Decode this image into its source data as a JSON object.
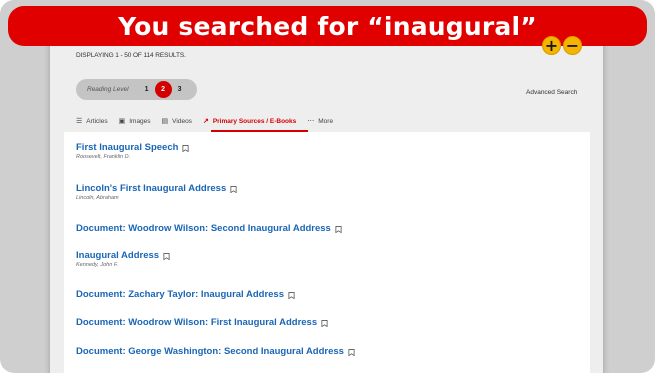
{
  "banner": {
    "title": "You searched for “inaugural”"
  },
  "zoom": {
    "in_label": "+",
    "out_label": "−"
  },
  "results_summary": "DISPLAYING 1 - 50 OF 114 RESULTS.",
  "reading_level": {
    "label": "Reading Level",
    "levels": [
      "1",
      "2",
      "3"
    ],
    "selected": "2"
  },
  "advanced_search_label": "Advanced Search",
  "tabs": [
    {
      "label": "Articles",
      "icon": "list-icon"
    },
    {
      "label": "Images",
      "icon": "image-icon"
    },
    {
      "label": "Videos",
      "icon": "film-icon"
    },
    {
      "label": "Primary Sources / E-Books",
      "icon": "external-link-icon",
      "active": true
    },
    {
      "label": "More",
      "icon": "ellipsis-icon"
    }
  ],
  "results": [
    {
      "title": "First Inaugural Speech",
      "author": "Roosevelt, Franklin D."
    },
    {
      "title": "Lincoln's First Inaugural Address",
      "author": "Lincoln, Abraham"
    },
    {
      "title": "Document: Woodrow Wilson: Second Inaugural Address",
      "author": ""
    },
    {
      "title": "Inaugural Address",
      "author": "Kennedy, John F."
    },
    {
      "title": "Document: Zachary Taylor: Inaugural Address",
      "author": ""
    },
    {
      "title": "Document: Woodrow Wilson: First Inaugural Address",
      "author": ""
    },
    {
      "title": "Document: George Washington: Second Inaugural Address",
      "author": ""
    }
  ],
  "colors": {
    "accent": "#d40000",
    "banner": "#e00000",
    "link": "#1a66b5",
    "zoom": "#f4b400"
  }
}
